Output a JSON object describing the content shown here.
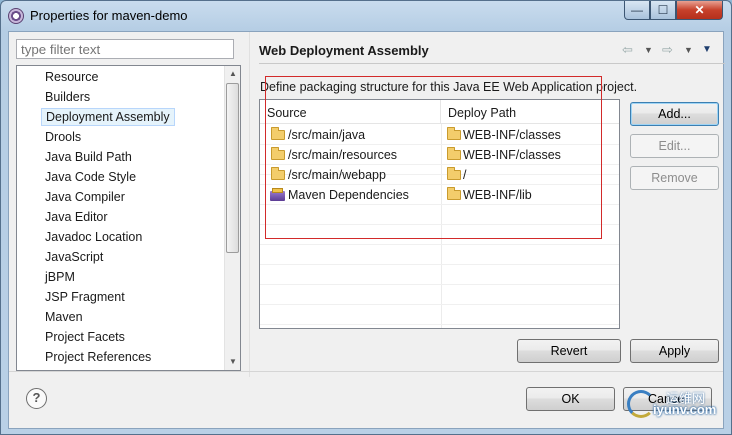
{
  "window": {
    "title": "Properties for maven-demo",
    "controls": {
      "minimize": "—",
      "maximize": "☐",
      "close": "✕"
    }
  },
  "filter": {
    "placeholder": "type filter text"
  },
  "nav": {
    "items": [
      {
        "label": "Resource"
      },
      {
        "label": "Builders"
      },
      {
        "label": "Deployment Assembly",
        "selected": true
      },
      {
        "label": "Drools"
      },
      {
        "label": "Java Build Path"
      },
      {
        "label": "Java Code Style"
      },
      {
        "label": "Java Compiler"
      },
      {
        "label": "Java Editor"
      },
      {
        "label": "Javadoc Location"
      },
      {
        "label": "JavaScript"
      },
      {
        "label": "jBPM"
      },
      {
        "label": "JSP Fragment"
      },
      {
        "label": "Maven"
      },
      {
        "label": "Project Facets"
      },
      {
        "label": "Project References"
      }
    ]
  },
  "page": {
    "title": "Web Deployment Assembly",
    "description": "Define packaging structure for this Java EE Web Application project."
  },
  "table": {
    "columns": [
      "Source",
      "Deploy Path"
    ],
    "rows": [
      {
        "source": "/src/main/java",
        "deploy": "WEB-INF/classes",
        "icon": "folder-icon"
      },
      {
        "source": "/src/main/resources",
        "deploy": "WEB-INF/classes",
        "icon": "folder-icon"
      },
      {
        "source": "/src/main/webapp",
        "deploy": "/",
        "icon": "folder-icon"
      },
      {
        "source": "Maven Dependencies",
        "deploy": "WEB-INF/lib",
        "icon": "library-icon"
      }
    ]
  },
  "buttons": {
    "add": "Add...",
    "edit": "Edit...",
    "remove": "Remove",
    "revert": "Revert",
    "apply": "Apply",
    "ok": "OK",
    "cancel": "Cancel"
  },
  "help": "?",
  "watermark": {
    "top": "运维网",
    "bottom": "iyunv.com"
  },
  "colors": {
    "highlight_box": "#d22a2a",
    "selection": "#e5f3fb"
  }
}
